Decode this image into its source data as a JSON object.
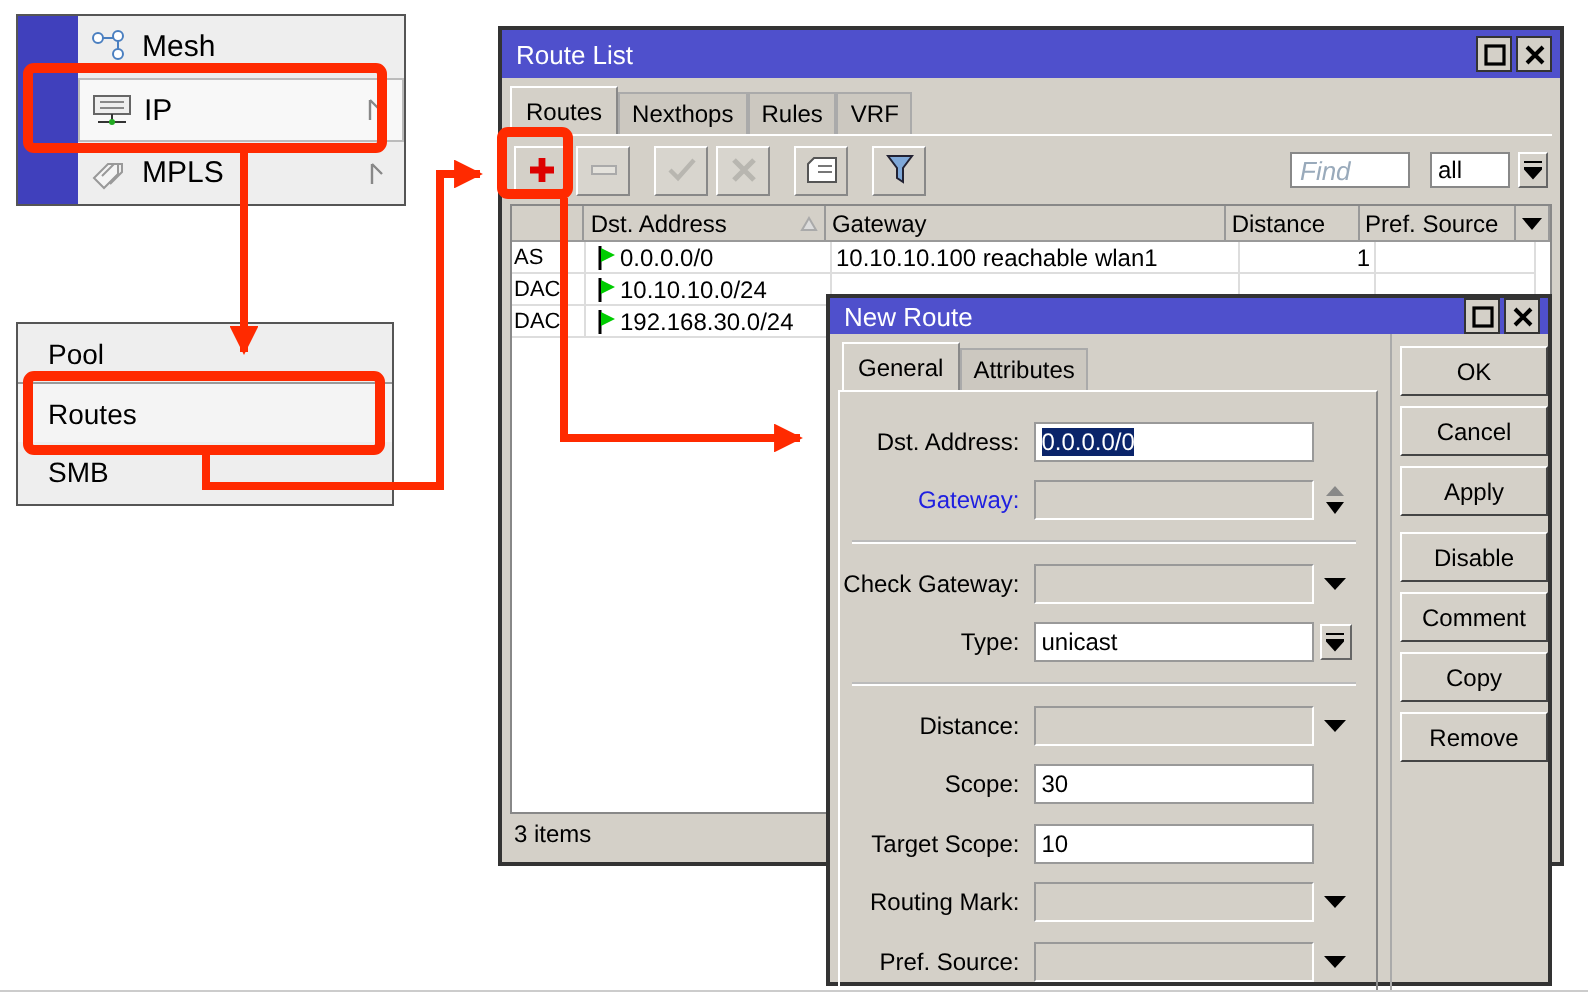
{
  "menu_1": {
    "items": [
      {
        "label": "Mesh",
        "selected": false,
        "submenu": false
      },
      {
        "label": "IP",
        "selected": true,
        "submenu": true
      },
      {
        "label": "MPLS",
        "selected": false,
        "submenu": true
      }
    ]
  },
  "menu_2": {
    "items": [
      {
        "label": "Pool",
        "selected": false
      },
      {
        "label": "Routes",
        "selected": true
      },
      {
        "label": "SMB",
        "selected": false
      }
    ]
  },
  "route_list": {
    "title": "Route List",
    "tabs": [
      {
        "label": "Routes",
        "selected": true
      },
      {
        "label": "Nexthops",
        "selected": false
      },
      {
        "label": "Rules",
        "selected": false
      },
      {
        "label": "VRF",
        "selected": false
      }
    ],
    "toolbar": {
      "buttons": [
        {
          "kind": "add",
          "disabled": false
        },
        {
          "kind": "remove",
          "disabled": true
        },
        {
          "kind": "enable",
          "disabled": true
        },
        {
          "kind": "disable",
          "disabled": true
        },
        {
          "kind": "comment",
          "disabled": false
        },
        {
          "kind": "filter",
          "disabled": false
        }
      ],
      "find_placeholder": "Find",
      "filter_value": "all"
    },
    "table": {
      "columns": [
        {
          "label": "Dst. Address",
          "sorted": true
        },
        {
          "label": "Gateway",
          "sorted": false
        },
        {
          "label": "Distance",
          "sorted": false
        },
        {
          "label": "Pref. Source",
          "sorted": false
        }
      ],
      "rows": [
        {
          "flags": "AS",
          "dst": "0.0.0.0/0",
          "gateway": "10.10.10.100 reachable wlan1",
          "distance": "1"
        },
        {
          "flags": "DAC",
          "dst": "10.10.10.0/24"
        },
        {
          "flags": "DAC",
          "dst": "192.168.30.0/24"
        }
      ]
    },
    "status": "3 items"
  },
  "new_route": {
    "title": "New Route",
    "tabs": [
      {
        "label": "General",
        "selected": true
      },
      {
        "label": "Attributes",
        "selected": false
      }
    ],
    "groups": [
      {
        "fields": [
          {
            "label": "Dst. Address:",
            "kind": "text",
            "value": "0.0.0.0/0",
            "value_selected": true,
            "emphasized": false
          },
          {
            "label": "Gateway:",
            "kind": "spinner",
            "emphasized": true
          }
        ]
      },
      {
        "fields": [
          {
            "label": "Check Gateway:",
            "kind": "combo",
            "emphasized": false
          },
          {
            "label": "Type:",
            "kind": "select",
            "value": "unicast",
            "emphasized": false
          }
        ]
      },
      {
        "fields": [
          {
            "label": "Distance:",
            "kind": "combo",
            "emphasized": false
          },
          {
            "label": "Scope:",
            "kind": "text",
            "value": "30",
            "emphasized": false,
            "value_selected": false
          },
          {
            "label": "Target Scope:",
            "kind": "text",
            "value": "10",
            "emphasized": false,
            "value_selected": false
          },
          {
            "label": "Routing Mark:",
            "kind": "combo",
            "emphasized": false
          },
          {
            "label": "Pref. Source:",
            "kind": "combo",
            "emphasized": false
          }
        ]
      }
    ],
    "button_groups": [
      [
        "OK",
        "Cancel",
        "Apply"
      ],
      [
        "Disable",
        "Comment",
        "Copy",
        "Remove"
      ]
    ]
  }
}
